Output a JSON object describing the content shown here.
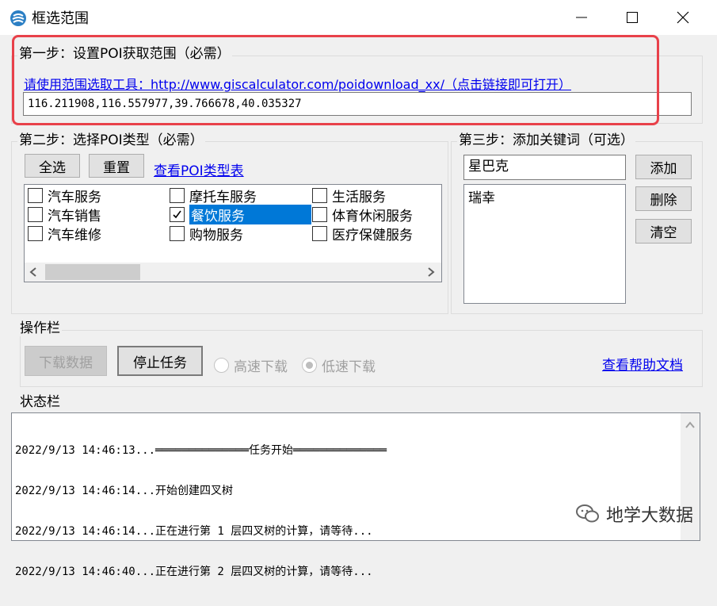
{
  "window": {
    "title": "框选范围"
  },
  "step1": {
    "label": "第一步：设置POI获取范围（必需）",
    "tool_link": "请使用范围选取工具：http://www.giscalculator.com/poidownload_xx/（点击链接即可打开）",
    "bbox_value": "116.211908,116.557977,39.766678,40.035327"
  },
  "step2": {
    "label": "第二步：选择POI类型（必需）",
    "select_all": "全选",
    "reset": "重置",
    "types_link": "查看POI类型表",
    "categories": [
      {
        "label": "汽车服务",
        "checked": false
      },
      {
        "label": "汽车销售",
        "checked": false
      },
      {
        "label": "汽车维修",
        "checked": false
      },
      {
        "label": "摩托车服务",
        "checked": false
      },
      {
        "label": "餐饮服务",
        "checked": true
      },
      {
        "label": "购物服务",
        "checked": false
      },
      {
        "label": "生活服务",
        "checked": false
      },
      {
        "label": "体育休闲服务",
        "checked": false
      },
      {
        "label": "医疗保健服务",
        "checked": false
      }
    ]
  },
  "step3": {
    "label": "第三步：添加关键词（可选）",
    "keyword_value": "星巴克",
    "add": "添加",
    "delete": "删除",
    "clear": "清空",
    "keywords": [
      "瑞幸"
    ]
  },
  "ops": {
    "label": "操作栏",
    "download": "下载数据",
    "stop": "停止任务",
    "fast": "高速下载",
    "slow": "低速下载",
    "slow_selected": true,
    "help_link": "查看帮助文档"
  },
  "status": {
    "label": "状态栏",
    "lines": [
      "2022/9/13 14:46:13...══════════════任务开始══════════════",
      "2022/9/13 14:46:14...开始创建四叉树",
      "2022/9/13 14:46:14...正在进行第 1 层四叉树的计算，请等待...",
      "2022/9/13 14:46:40...正在进行第 2 层四叉树的计算，请等待..."
    ]
  },
  "watermark": "地学大数据",
  "colors": {
    "highlight": "#e8414a",
    "selection": "#0078d7",
    "link": "#0000ee"
  }
}
